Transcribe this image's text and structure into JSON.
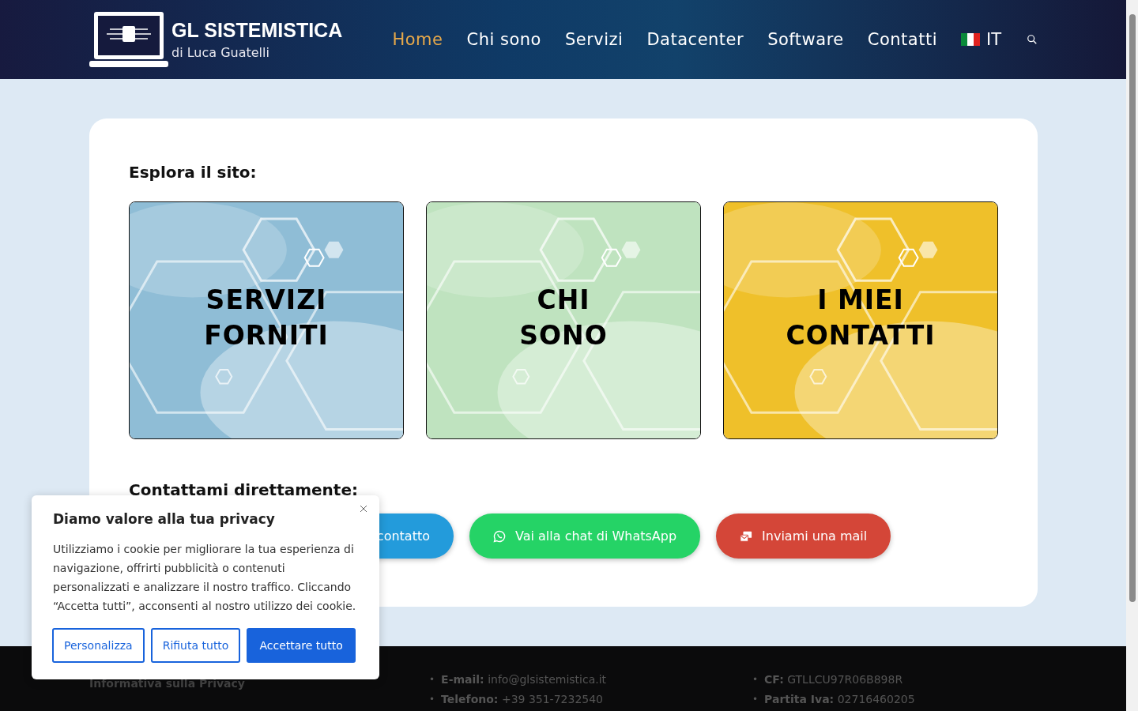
{
  "header": {
    "logo_title": "GL SISTEMISTICA",
    "logo_subtitle": "di Luca Guatelli",
    "nav": [
      {
        "label": "Home",
        "selected": true
      },
      {
        "label": "Chi sono",
        "selected": false
      },
      {
        "label": "Servizi",
        "selected": false
      },
      {
        "label": "Datacenter",
        "selected": false
      },
      {
        "label": "Software",
        "selected": false
      },
      {
        "label": "Contatti",
        "selected": false
      }
    ],
    "language": "IT"
  },
  "explore": {
    "heading": "Esplora il sito:",
    "tiles": [
      {
        "title": "SERVIZI\nFORNITI",
        "color": "#8fbdd6"
      },
      {
        "title": "CHI\nSONO",
        "color": "#bfe3bf"
      },
      {
        "title": "I MIEI\nCONTATTI",
        "color": "#efc02a"
      }
    ]
  },
  "contact": {
    "heading": "Contattami direttamente:",
    "buttons": [
      {
        "kind": "form",
        "label": "contatto",
        "color": "#239bdb"
      },
      {
        "kind": "whatsapp",
        "label": "Vai alla chat di WhatsApp",
        "color": "#25d366"
      },
      {
        "kind": "mail",
        "label": "Inviami una mail",
        "color": "#d44638"
      }
    ]
  },
  "footer": {
    "privacy_link": "Informativa sulla Privacy",
    "bullet": "•",
    "column_1": [
      {
        "label": "E-mail:",
        "value": "info@glsistemistica.it"
      },
      {
        "label": "Telefono:",
        "value": "+39 351-7232540"
      }
    ],
    "column_2": [
      {
        "label": "CF:",
        "value": "GTLLCU97R06B898R"
      },
      {
        "label": "Partita Iva:",
        "value": "02716460205"
      }
    ]
  },
  "cookie_banner": {
    "title": "Diamo valore alla tua privacy",
    "text": "Utilizziamo i cookie per migliorare la tua esperienza di navigazione, offrirti pubblicità o contenuti personalizzati e analizzare il nostro traffico. Cliccando “Accetta tutti”, acconsenti al nostro utilizzo dei cookie.",
    "buttons": [
      {
        "label": "Personalizza",
        "kind": "outline"
      },
      {
        "label": "Rifiuta tutto",
        "kind": "outline"
      },
      {
        "label": "Accettare tutto",
        "kind": "primary"
      }
    ]
  }
}
